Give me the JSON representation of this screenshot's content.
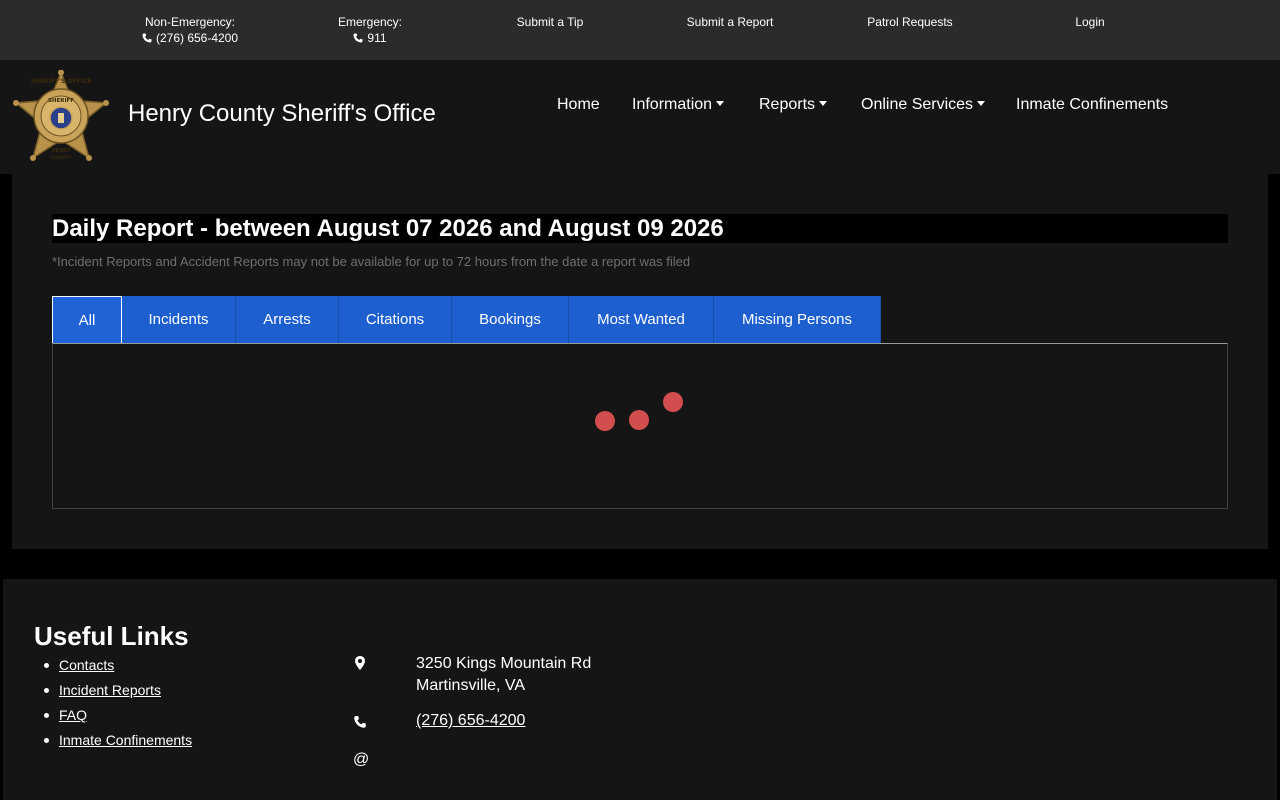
{
  "topbar": {
    "non_emergency_label": "Non-Emergency:",
    "non_emergency_phone": "(276) 656-4200",
    "emergency_label": "Emergency:",
    "emergency_phone": "911",
    "submit_tip": "Submit a Tip",
    "submit_report": "Submit a Report",
    "patrol_requests": "Patrol Requests",
    "login": "Login"
  },
  "header": {
    "site_title": "Henry County Sheriff's Office",
    "badge_text": {
      "top": "SHERIFF'S OFFICE",
      "center": "SHERIFF",
      "bottom_1": "HENRY",
      "bottom_2": "COUNTY"
    },
    "nav": {
      "home": "Home",
      "information": "Information",
      "reports": "Reports",
      "online_services": "Online Services",
      "inmate_confinements": "Inmate Confinements"
    }
  },
  "main": {
    "report_title": "Daily Report - between August 07 2026 and August 09 2026",
    "note": "*Incident Reports and Accident Reports may not be available for up to 72 hours from the date a report was filed",
    "tabs": [
      {
        "label": "All",
        "active": true
      },
      {
        "label": "Incidents",
        "active": false
      },
      {
        "label": "Arrests",
        "active": false
      },
      {
        "label": "Citations",
        "active": false
      },
      {
        "label": "Bookings",
        "active": false
      },
      {
        "label": "Most Wanted",
        "active": false
      },
      {
        "label": "Missing Persons",
        "active": false
      }
    ],
    "loading_dot_color": "#d24e4e"
  },
  "footer": {
    "useful_links_title": "Useful Links",
    "links": [
      "Contacts",
      "Incident Reports",
      "FAQ",
      "Inmate Confinements"
    ],
    "address_line1": "3250 Kings Mountain Rd",
    "address_line2": "Martinsville, VA",
    "phone": "(276) 656-4200",
    "email_icon": "@"
  },
  "colors": {
    "tab_blue": "#1e5fcf",
    "topbar_bg": "#2b2b2b",
    "panel_bg": "#151515"
  }
}
